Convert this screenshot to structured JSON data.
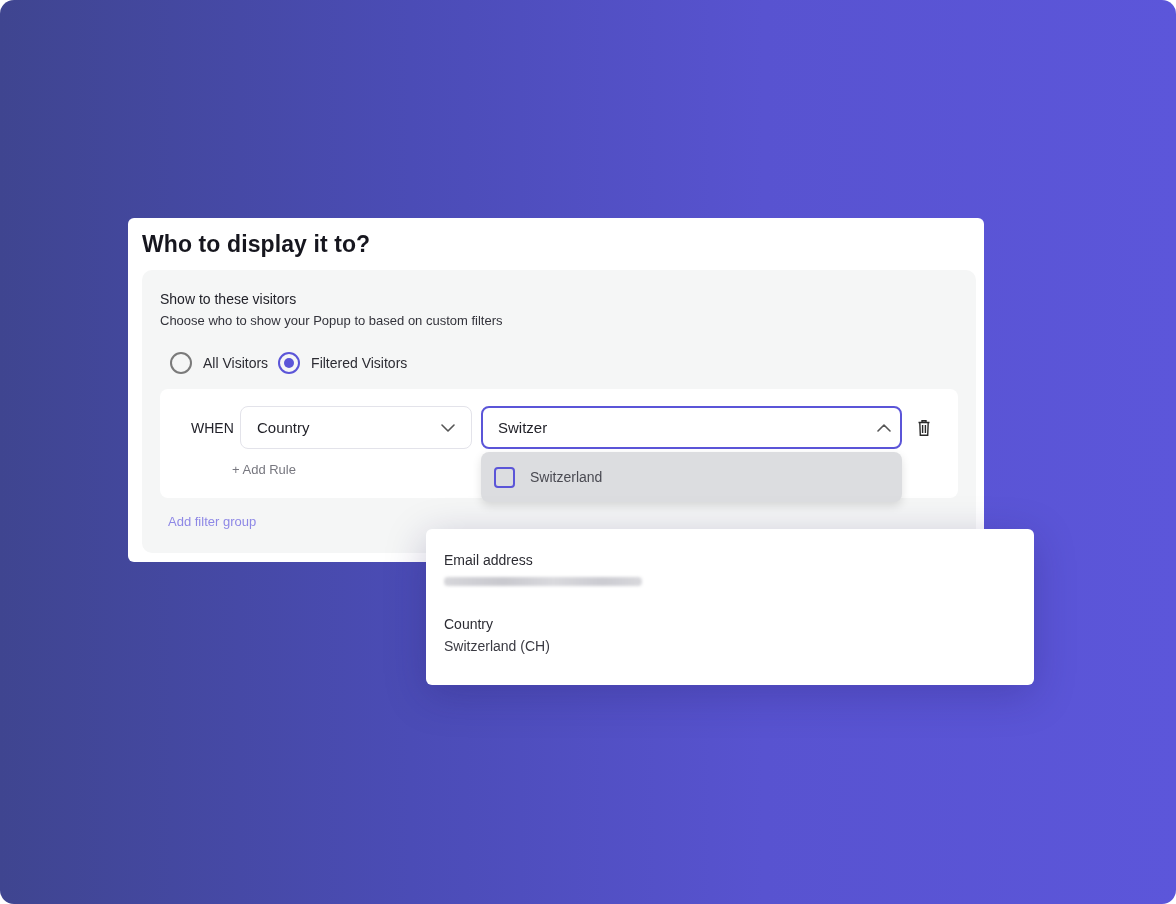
{
  "card": {
    "title": "Who to display it to?"
  },
  "section": {
    "heading": "Show to these visitors",
    "description": "Choose who to show your Popup to based on custom filters"
  },
  "audience_options": [
    {
      "label": "All Visitors",
      "selected": false
    },
    {
      "label": "Filtered Visitors",
      "selected": true
    }
  ],
  "rule": {
    "connector": "WHEN",
    "field_select": {
      "value": "Country",
      "expanded": false
    },
    "value_select": {
      "value": "Switzer",
      "expanded": true
    },
    "options": [
      {
        "label": "Switzerland",
        "checked": false
      }
    ],
    "add_rule": "+ Add Rule"
  },
  "add_filter_group": "Add filter group",
  "visitor_card": {
    "fields": [
      {
        "kind": "redacted",
        "label": "Email address"
      },
      {
        "kind": "text",
        "label": "Country",
        "value": "Switzerland (CH)"
      }
    ]
  }
}
